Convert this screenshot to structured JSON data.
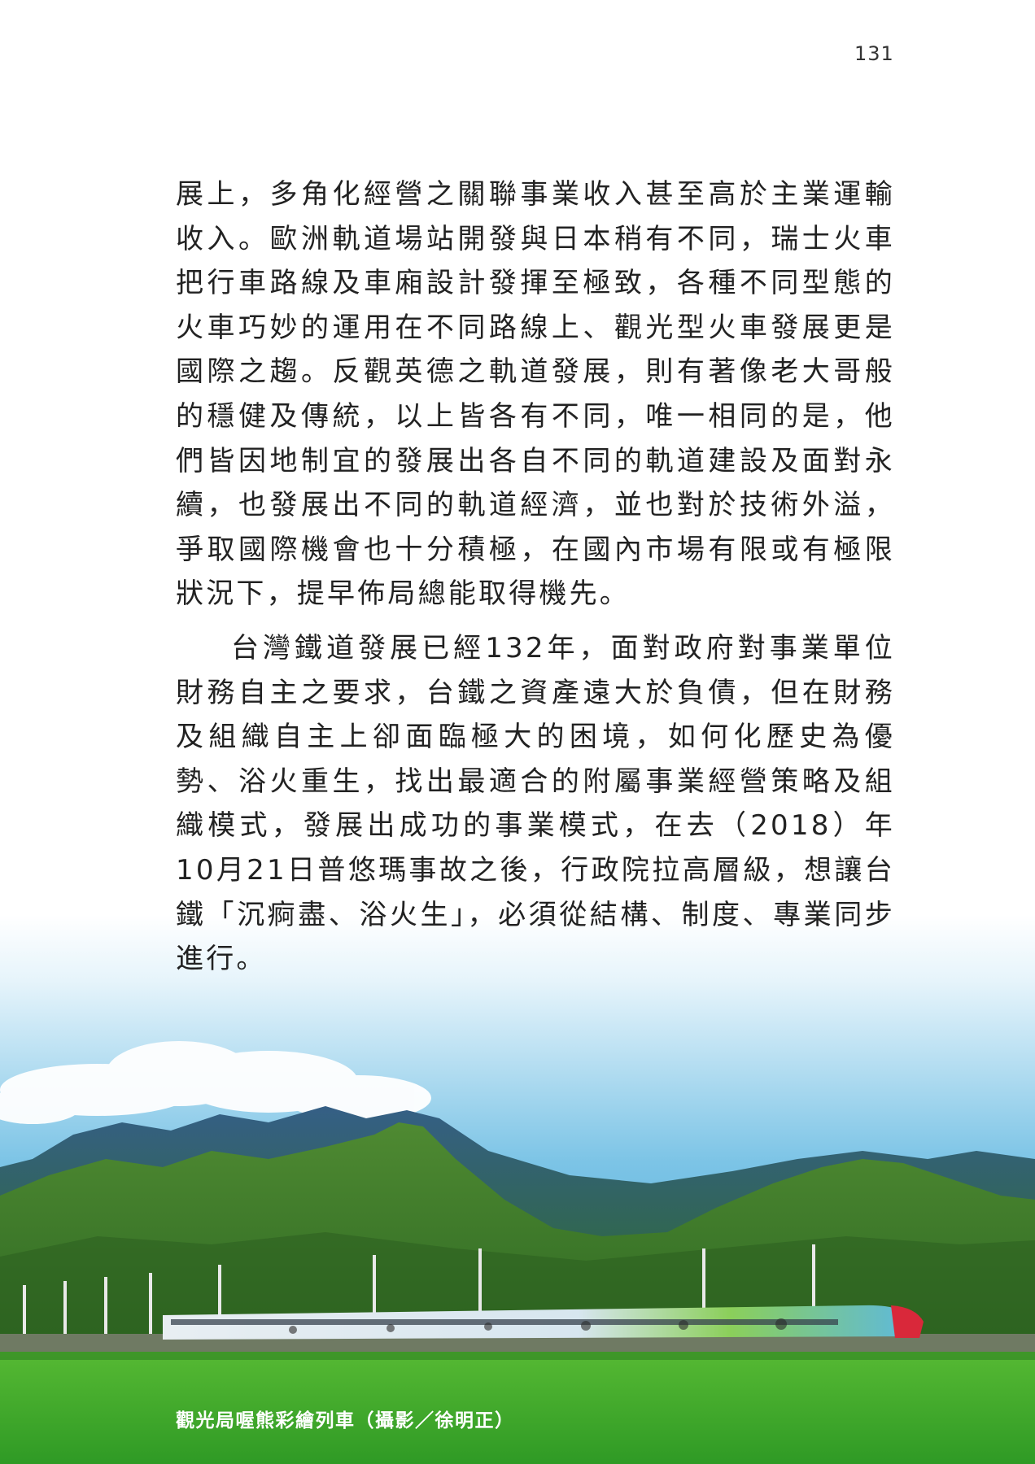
{
  "page_number": "131",
  "paragraphs": [
    "展上，多角化經營之關聯事業收入甚至高於主業運輸收入。歐洲軌道場站開發與日本稍有不同，瑞士火車把行車路線及車廂設計發揮至極致，各種不同型態的火車巧妙的運用在不同路線上、觀光型火車發展更是國際之趨。反觀英德之軌道發展，則有著像老大哥般的穩健及傳統，以上皆各有不同，唯一相同的是，他們皆因地制宜的發展出各自不同的軌道建設及面對永續，也發展出不同的軌道經濟，並也對於技術外溢，爭取國際機會也十分積極，在國內市場有限或有極限狀況下，提早佈局總能取得機先。",
    "台灣鐵道發展已經132年，面對政府對事業單位財務自主之要求，台鐵之資產遠大於負債，但在財務及組織自主上卻面臨極大的困境，如何化歷史為優勢、浴火重生，找出最適合的附屬事業經營策略及組織模式，發展出成功的事業模式，在去（2018）年10月21日普悠瑪事故之後，行政院拉高層級，想讓台鐵「沉痾盡、浴火生」，必須從結構、制度、專業同步進行。"
  ],
  "photo": {
    "caption": "觀光局喔熊彩繪列車（攝影／徐明正）",
    "colors": {
      "sky_top": "#ffffff",
      "sky_bottom": "#3fa6d6",
      "mountain": "#3f7f2e",
      "field": "#3fae2c",
      "train_nose": "#d9283a"
    }
  }
}
